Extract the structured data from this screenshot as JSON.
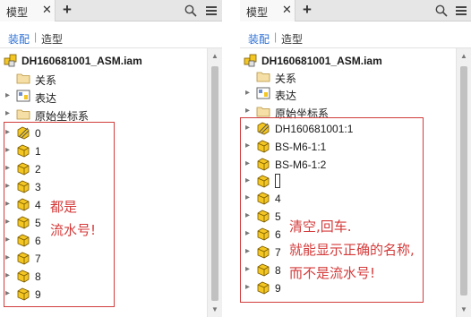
{
  "left": {
    "tab": {
      "label": "模型",
      "close": "✕"
    },
    "add": "+",
    "modes": {
      "assembly": "装配",
      "separator": "|",
      "modeling": "造型"
    },
    "root": "DH160681001_ASM.iam",
    "folders": [
      "关系",
      "表达",
      "原始坐标系"
    ],
    "items": [
      "0",
      "1",
      "2",
      "3",
      "4",
      "5",
      "6",
      "7",
      "8",
      "9"
    ],
    "note_lines": [
      "都是",
      "流水号!"
    ]
  },
  "right": {
    "tab": {
      "label": "模型",
      "close": "✕"
    },
    "add": "+",
    "modes": {
      "assembly": "装配",
      "separator": "|",
      "modeling": "造型"
    },
    "root": "DH160681001_ASM.iam",
    "folders": [
      "关系",
      "表达",
      "原始坐标系"
    ],
    "items": [
      "DH160681001:1",
      "BS-M6-1:1",
      "BS-M6-1:2",
      "",
      "4",
      "5",
      "6",
      "7",
      "8",
      "9"
    ],
    "note_lines": [
      "清空,回车.",
      "就能显示正确的名称,",
      "而不是流水号!"
    ]
  },
  "colors": {
    "accent": "#2b6fd4",
    "annotation": "#d43a3a",
    "part_yellow": "#f3c623"
  }
}
